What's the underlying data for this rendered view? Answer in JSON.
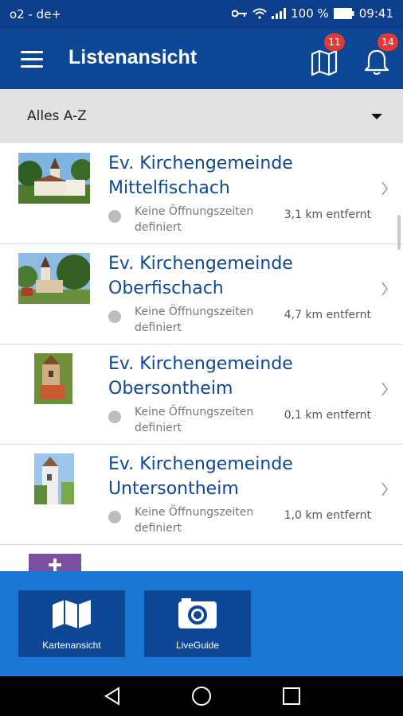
{
  "status_bar": {
    "carrier": "o2 - de+",
    "battery": "100 %",
    "time": "09:41"
  },
  "app_bar": {
    "title": "Listenansicht",
    "map_badge": "11",
    "notifications_badge": "14"
  },
  "sort": {
    "selected": "Alles A-Z"
  },
  "list": [
    {
      "name": "Ev. Kirchengemeinde Mittelfischach",
      "hours": "Keine Öffnungszeiten definiert",
      "distance": "3,1 km entfernt"
    },
    {
      "name": "Ev. Kirchengemeinde Oberfischach",
      "hours": "Keine Öffnungszeiten definiert",
      "distance": "4,7 km entfernt"
    },
    {
      "name": "Ev. Kirchengemeinde Obersontheim",
      "hours": "Keine Öffnungszeiten definiert",
      "distance": "0,1 km entfernt"
    },
    {
      "name": "Ev. Kirchengemeinde Untersontheim",
      "hours": "Keine Öffnungszeiten definiert",
      "distance": "1,0 km entfernt"
    }
  ],
  "bottom": {
    "map_label": "Kartenansicht",
    "guide_label": "LiveGuide"
  },
  "colors": {
    "primary": "#0d4796",
    "status": "#0d3e8c",
    "bottom": "#1976d2",
    "badge": "#e53935"
  }
}
